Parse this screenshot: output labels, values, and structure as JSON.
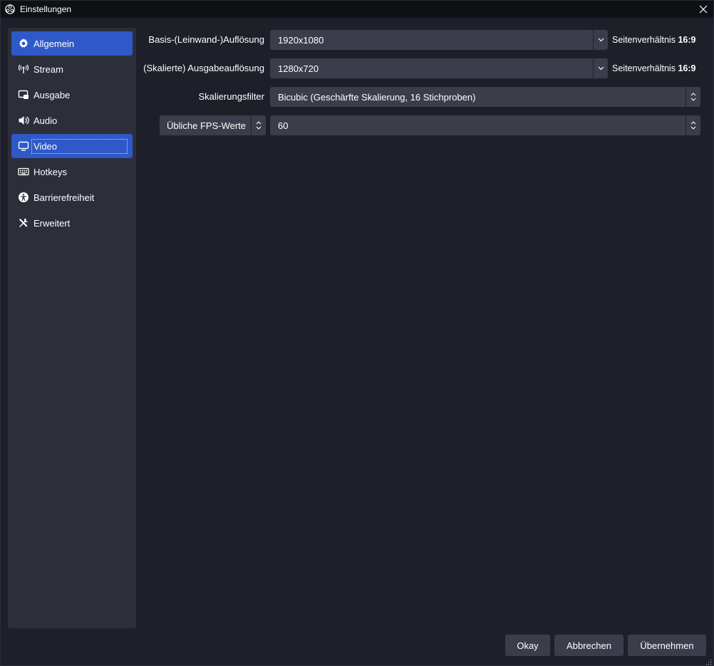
{
  "window": {
    "title": "Einstellungen"
  },
  "sidebar": {
    "items": [
      {
        "label": "Allgemein",
        "icon": "gear-icon"
      },
      {
        "label": "Stream",
        "icon": "antenna-icon"
      },
      {
        "label": "Ausgabe",
        "icon": "output-icon"
      },
      {
        "label": "Audio",
        "icon": "speaker-icon"
      },
      {
        "label": "Video",
        "icon": "monitor-icon"
      },
      {
        "label": "Hotkeys",
        "icon": "keyboard-icon"
      },
      {
        "label": "Barrierefreiheit",
        "icon": "accessibility-icon"
      },
      {
        "label": "Erweitert",
        "icon": "tools-icon"
      }
    ],
    "active": "Allgemein",
    "selected": "Video"
  },
  "video": {
    "base_resolution": {
      "label": "Basis-(Leinwand-)Auflösung",
      "value": "1920x1080",
      "aspect_prefix": "Seitenverhältnis",
      "aspect_value": "16:9"
    },
    "output_resolution": {
      "label": "(Skalierte) Ausgabeauflösung",
      "value": "1280x720",
      "aspect_prefix": "Seitenverhältnis",
      "aspect_value": "16:9"
    },
    "scale_filter": {
      "label": "Skalierungsfilter",
      "value": "Bicubic (Geschärfte Skalierung, 16 Stichproben)"
    },
    "fps": {
      "type_value": "Übliche FPS-Werte",
      "value": "60"
    }
  },
  "buttons": {
    "ok": "Okay",
    "cancel": "Abbrechen",
    "apply": "Übernehmen"
  },
  "colors": {
    "accent": "#2f59c8",
    "background": "#1e2029",
    "panel": "#2c2e3a",
    "control": "#3b3d4b",
    "titlebar": "#0f1014"
  }
}
